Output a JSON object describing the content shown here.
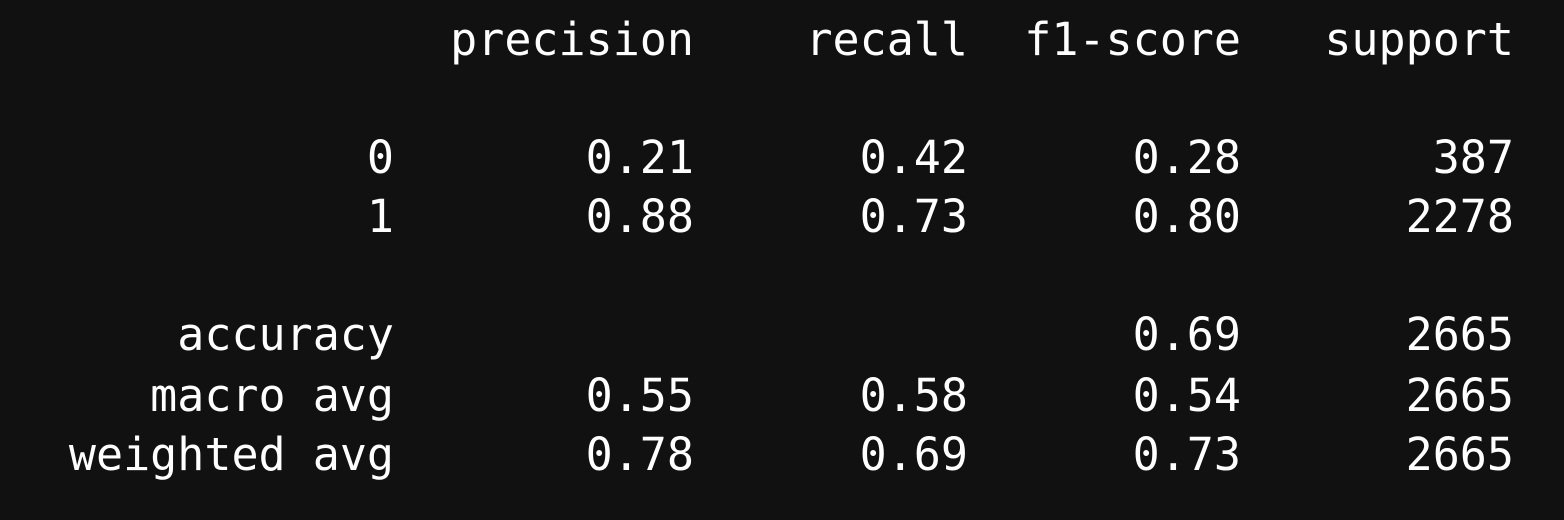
{
  "report": {
    "header": {
      "precision": "precision",
      "recall": "recall",
      "f1": "f1-score",
      "support": "support"
    },
    "rows": [
      {
        "label": "0",
        "precision": "0.21",
        "recall": "0.42",
        "f1": "0.28",
        "support": "387"
      },
      {
        "label": "1",
        "precision": "0.88",
        "recall": "0.73",
        "f1": "0.80",
        "support": "2278"
      },
      {
        "label": "accuracy",
        "precision": "",
        "recall": "",
        "f1": "0.69",
        "support": "2665"
      },
      {
        "label": "macro avg",
        "precision": "0.55",
        "recall": "0.58",
        "f1": "0.54",
        "support": "2665"
      },
      {
        "label": "weighted avg",
        "precision": "0.78",
        "recall": "0.69",
        "f1": "0.73",
        "support": "2665"
      }
    ]
  },
  "colors": {
    "background": "#111111",
    "text": "#ffffff"
  }
}
